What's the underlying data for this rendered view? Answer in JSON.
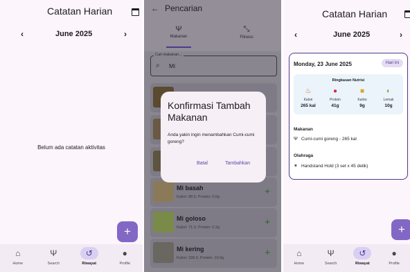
{
  "panel1": {
    "title": "Catatan Harian",
    "month": "June 2025",
    "prev": "‹",
    "next": "›",
    "empty_message": "Belum ada catatan aktivitas",
    "fab": "+"
  },
  "panel2": {
    "title": "Pencarian",
    "tabs": [
      {
        "label": "Makanan",
        "icon": "fork-knife-icon"
      },
      {
        "label": "Fitness",
        "icon": "dumbbell-icon"
      }
    ],
    "search": {
      "label": "Cari makanan...",
      "value": "Mi"
    },
    "foods": [
      {
        "name": "Mi basah",
        "meta": "Kalori: 88.0, Protein: 0.6g"
      },
      {
        "name": "Mi goloso",
        "meta": "Kalori: 71.0, Protein: 0.2g"
      },
      {
        "name": "Mi kering",
        "meta": "Kalori: 339.0, Protein: 10.0g"
      }
    ],
    "dialog": {
      "title": "Konfirmasi Tambah Makanan",
      "body": "Anda yakin ingin menambahkan Cumi-cumi goreng?",
      "cancel": "Batal",
      "confirm": "Tambahkan"
    }
  },
  "panel3": {
    "title": "Catatan Harian",
    "month": "June 2025",
    "prev": "‹",
    "next": "›",
    "date": "Monday, 23 June 2025",
    "today_chip": "Hari Ini",
    "nutrition": {
      "title": "Ringkasan Nutrisi",
      "items": [
        {
          "label": "Kalori",
          "value": "265 kal",
          "icon": "fire-icon"
        },
        {
          "label": "Protein",
          "value": "41g",
          "icon": "meat-icon"
        },
        {
          "label": "Karbo",
          "value": "9g",
          "icon": "bread-icon"
        },
        {
          "label": "Lemak",
          "value": "10g",
          "icon": "avocado-icon"
        }
      ]
    },
    "meals_heading": "Makanan",
    "meal_item": "Cumi-cumi goreng - 265 kal",
    "exercise_heading": "Olahraga",
    "exercise_item": "Handstand Hold (3 set x 45 detik)",
    "fab": "+"
  },
  "nav": [
    {
      "label": "Home",
      "icon": "home-icon"
    },
    {
      "label": "Search",
      "icon": "fork-knife-icon"
    },
    {
      "label": "Riwayat",
      "icon": "history-icon"
    },
    {
      "label": "Profile",
      "icon": "person-icon"
    }
  ],
  "colors": {
    "accent": "#4a3b8c",
    "fab": "#8268c4",
    "active_nav": "#d9cff3"
  }
}
